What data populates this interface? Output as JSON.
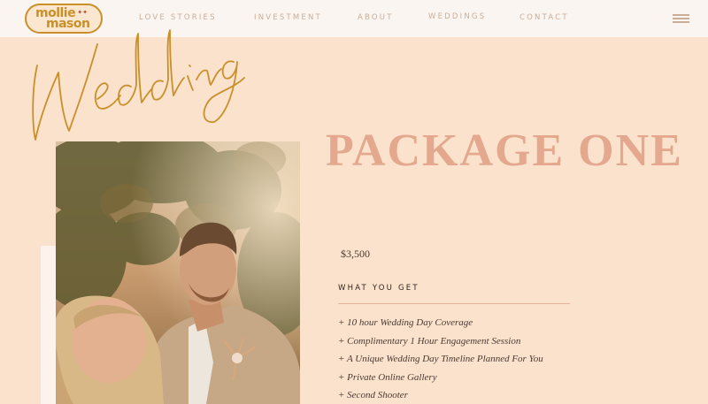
{
  "brand": {
    "line1": "mollie",
    "line2": "mason"
  },
  "nav": {
    "items": [
      "LOVE STORIES",
      "INVESTMENT",
      "ABOUT",
      "WEDDINGS",
      "CONTACT"
    ]
  },
  "hero": {
    "script_title": "Weddings"
  },
  "package": {
    "title": "PACKAGE ONE",
    "price": "$3,500",
    "section_label": "WHAT YOU GET",
    "features": [
      "+ 10 hour Wedding Day Coverage",
      "+ Complimentary 1 Hour Engagement Session",
      "+ A Unique Wedding Day Timeline Planned For You",
      "+ Private Online Gallery",
      "+ Second Shooter"
    ]
  },
  "colors": {
    "background": "#fbe2cd",
    "header": "#fbf5f1",
    "gold": "#c9902a",
    "title_pink": "#e3a88e",
    "nav_text": "#c9ad96"
  },
  "icons": {
    "menu": "hamburger-menu-icon"
  }
}
